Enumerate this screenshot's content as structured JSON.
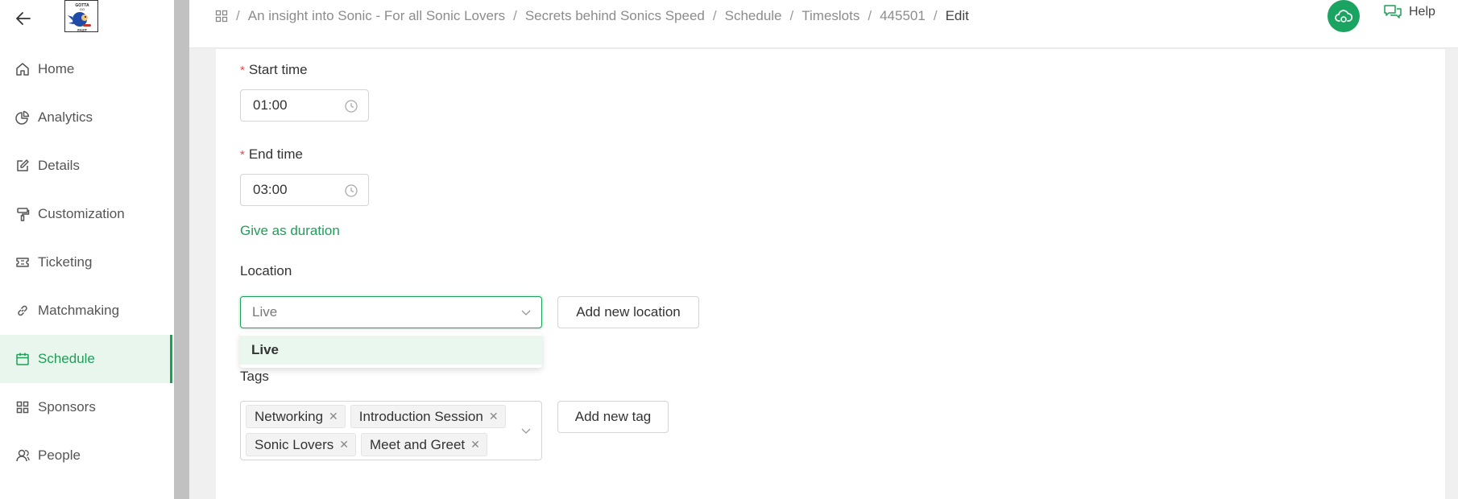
{
  "breadcrumb": {
    "items": [
      "An insight into Sonic - For all Sonic Lovers",
      "Secrets behind Sonics Speed",
      "Schedule",
      "Timeslots",
      "445501"
    ],
    "current": "Edit"
  },
  "header": {
    "help_label": "Help"
  },
  "sidebar": {
    "logo_text": "GOTTA GO FAST",
    "items": [
      {
        "label": "Home",
        "icon": "home-icon"
      },
      {
        "label": "Analytics",
        "icon": "pie-chart-icon"
      },
      {
        "label": "Details",
        "icon": "edit-icon"
      },
      {
        "label": "Customization",
        "icon": "paint-roller-icon"
      },
      {
        "label": "Ticketing",
        "icon": "ticket-icon"
      },
      {
        "label": "Matchmaking",
        "icon": "link-icon"
      },
      {
        "label": "Schedule",
        "icon": "calendar-icon",
        "active": true
      },
      {
        "label": "Sponsors",
        "icon": "grid-icon"
      },
      {
        "label": "People",
        "icon": "people-icon"
      }
    ]
  },
  "form": {
    "start_time": {
      "label": "Start time",
      "value": "01:00"
    },
    "end_time": {
      "label": "End time",
      "value": "03:00"
    },
    "duration_link": "Give as duration",
    "location": {
      "label": "Location",
      "value": "Live",
      "add_button": "Add new location",
      "options": [
        "Live"
      ]
    },
    "tags": {
      "label": "Tags",
      "values": [
        "Networking",
        "Introduction Session",
        "Sonic Lovers",
        "Meet and Greet"
      ],
      "add_button": "Add new tag"
    }
  },
  "colors": {
    "accent": "#1e9e57",
    "accent_bg": "#e8f6ee",
    "cloud_button": "#1aa361",
    "required": "#e5484d"
  }
}
